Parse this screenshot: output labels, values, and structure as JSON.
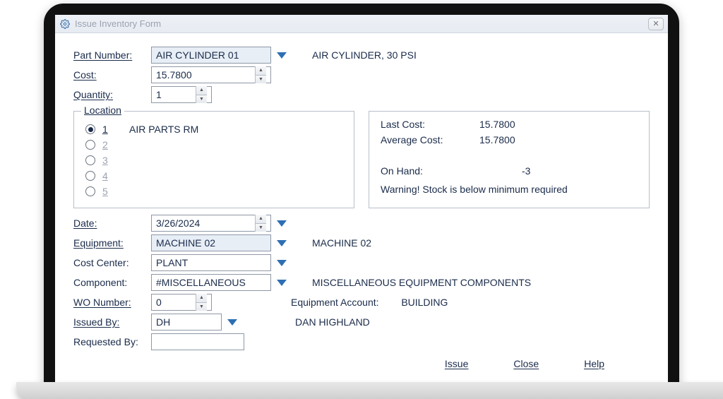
{
  "window": {
    "title": "Issue Inventory Form"
  },
  "labels": {
    "part_number": "Part Number:",
    "cost": "Cost:",
    "quantity": "Quantity:",
    "location_legend": "Location",
    "date": "Date:",
    "equipment": "Equipment:",
    "cost_center": "Cost Center:",
    "component": "Component:",
    "wo_number": "WO Number:",
    "issued_by": "Issued By:",
    "requested_by": "Requested By:"
  },
  "fields": {
    "part_number": "AIR CYLINDER 01",
    "part_desc": "AIR CYLINDER, 30 PSI",
    "cost": "15.7800",
    "quantity": "1",
    "date": "3/26/2024",
    "equipment": "MACHINE 02",
    "equipment_desc": "MACHINE 02",
    "cost_center": "PLANT",
    "component": "#MISCELLANEOUS",
    "component_desc": "MISCELLANEOUS EQUIPMENT COMPONENTS",
    "equipment_account_label": "Equipment Account:",
    "equipment_account": "BUILDING",
    "wo_number": "0",
    "issued_by": "DH",
    "issued_by_desc": "DAN HIGHLAND",
    "requested_by": ""
  },
  "locations": [
    {
      "n": "1",
      "selected": true,
      "desc": "AIR PARTS RM"
    },
    {
      "n": "2",
      "selected": false,
      "desc": ""
    },
    {
      "n": "3",
      "selected": false,
      "desc": ""
    },
    {
      "n": "4",
      "selected": false,
      "desc": ""
    },
    {
      "n": "5",
      "selected": false,
      "desc": ""
    }
  ],
  "cost_info": {
    "last_cost_label": "Last Cost:",
    "last_cost": "15.7800",
    "avg_cost_label": "Average Cost:",
    "avg_cost": "15.7800",
    "on_hand_label": "On Hand:",
    "on_hand": "-3",
    "warning": "Warning! Stock is below minimum required"
  },
  "footer": {
    "issue": "Issue",
    "close": "Close",
    "help": "Help"
  }
}
